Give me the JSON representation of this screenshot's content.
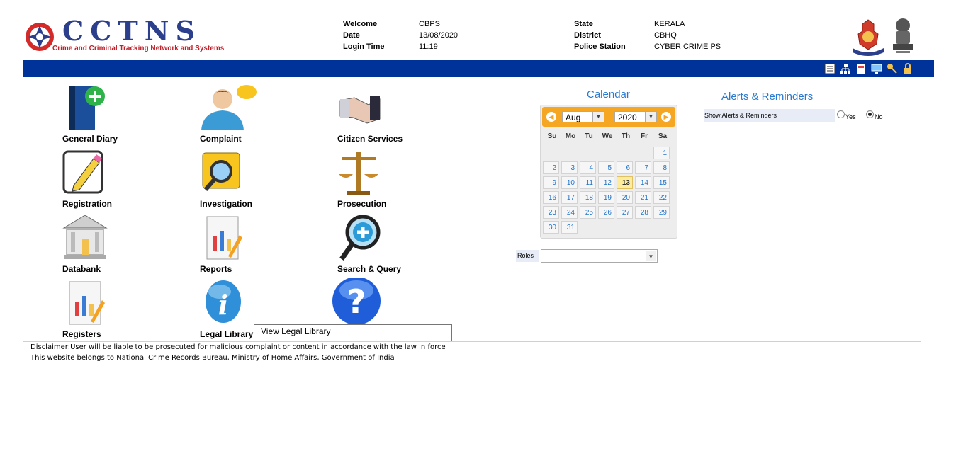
{
  "header": {
    "logo_text": "CCTNS",
    "logo_subtitle": "Crime and Criminal Tracking Network and Systems",
    "welcome_label": "Welcome",
    "welcome_value": "CBPS",
    "date_label": "Date",
    "date_value": "13/08/2020",
    "login_time_label": "Login Time",
    "login_time_value": "11:19",
    "state_label": "State",
    "state_value": "KERALA",
    "district_label": "District",
    "district_value": "CBHQ",
    "station_label": "Police Station",
    "station_value": "CYBER CRIME PS"
  },
  "toolbar": {
    "icons": [
      "report-icon",
      "org-chart-icon",
      "document-icon",
      "monitor-icon",
      "key-icon",
      "lock-icon"
    ]
  },
  "modules": [
    {
      "label": "General Diary",
      "icon": "general-diary-icon"
    },
    {
      "label": "Complaint",
      "icon": "complaint-icon"
    },
    {
      "label": "Citizen Services",
      "icon": "handshake-icon"
    },
    {
      "label": "Registration",
      "icon": "registration-icon"
    },
    {
      "label": "Investigation",
      "icon": "investigation-icon"
    },
    {
      "label": "Prosecution",
      "icon": "scales-icon"
    },
    {
      "label": "Databank",
      "icon": "bank-icon"
    },
    {
      "label": "Reports",
      "icon": "reports-icon"
    },
    {
      "label": "Search & Query",
      "icon": "search-query-icon"
    },
    {
      "label": "Registers",
      "icon": "registers-icon"
    },
    {
      "label": "Legal Library",
      "icon": "info-icon"
    },
    {
      "label": "",
      "icon": "help-icon"
    }
  ],
  "tooltip": "View Legal Library",
  "calendar": {
    "title": "Calendar",
    "month": "Aug",
    "year": "2020",
    "weekdays": [
      "Su",
      "Mo",
      "Tu",
      "We",
      "Th",
      "Fr",
      "Sa"
    ],
    "first_weekday_index": 6,
    "days_in_month": 31,
    "today": 13,
    "accent": "#f5a623"
  },
  "roles": {
    "label": "Roles",
    "value": ""
  },
  "alerts": {
    "title": "Alerts & Reminders",
    "show_label": "Show Alerts & Reminders",
    "yes_label": "Yes",
    "no_label": "No",
    "selected": "No"
  },
  "footer": {
    "disclaimer": "Disclaimer:User will be liable to be prosecuted for malicious complaint or content in accordance with the law in force",
    "ownership": "This website belongs to National Crime Records Bureau, Ministry of Home Affairs, Government of India"
  },
  "colors": {
    "navbar": "#003399",
    "logo_blue": "#2b3f8c",
    "logo_red": "#c0202a",
    "heading_blue": "#2b7ad1"
  }
}
